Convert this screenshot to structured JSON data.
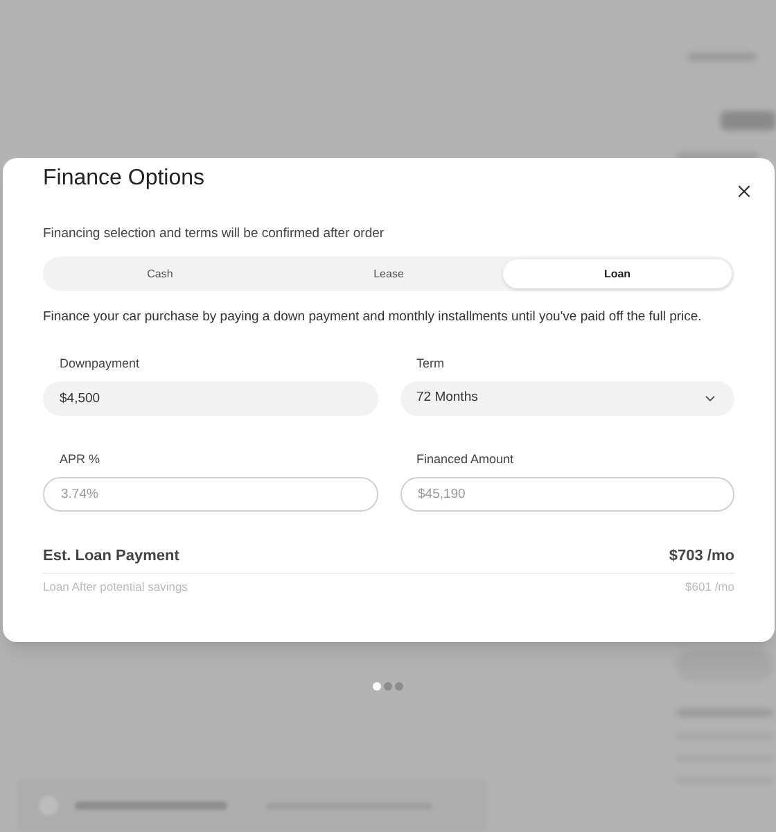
{
  "dialog": {
    "title": "Finance Options",
    "notice": "Financing selection and terms will be confirmed after order",
    "tabs": [
      {
        "label": "Cash",
        "selected": false
      },
      {
        "label": "Lease",
        "selected": false
      },
      {
        "label": "Loan",
        "selected": true
      }
    ],
    "description": "Finance your car purchase by paying a down payment and monthly installments until you've paid off the full price.",
    "fields": [
      {
        "label": "Downpayment",
        "kind": "filled",
        "value": "$4,500"
      },
      {
        "label": "Term",
        "kind": "select",
        "value": "72 Months"
      },
      {
        "label": "APR %",
        "kind": "outlined",
        "placeholder": "3.74%"
      },
      {
        "label": "Financed Amount",
        "kind": "outlined",
        "placeholder": "$45,190"
      }
    ],
    "payment": {
      "label": "Est. Loan Payment",
      "value": "$703 /mo"
    },
    "savings": {
      "label": "Loan After potential savings",
      "value": "$601 /mo"
    }
  },
  "pager": [
    {
      "selected": true
    },
    {
      "selected": false
    },
    {
      "selected": false
    }
  ]
}
